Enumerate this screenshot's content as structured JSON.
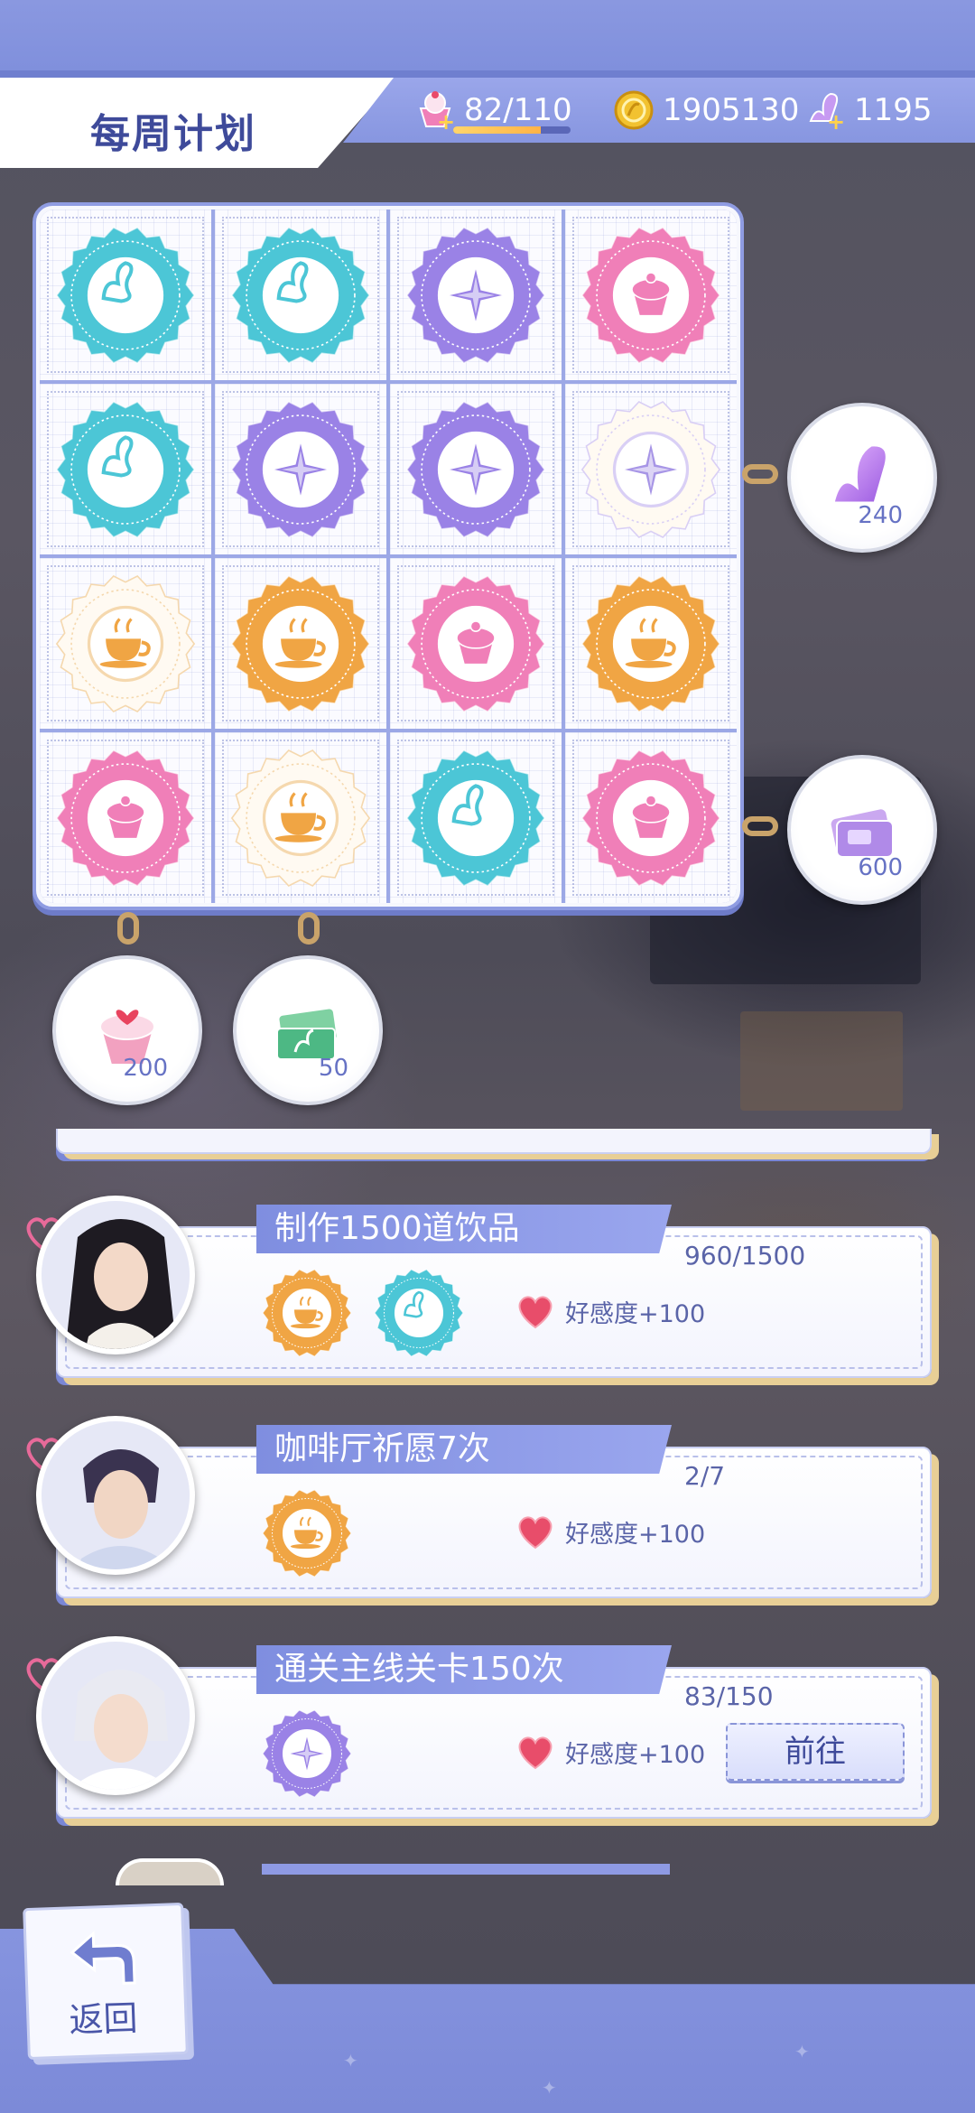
{
  "header": {
    "title": "每周计划",
    "stamina": {
      "value": "82/110",
      "fill": 0.745
    },
    "gold": "1905130",
    "gems": "1195"
  },
  "board": {
    "stamps": [
      [
        "swan-stamp-teal",
        "swan-stamp-teal",
        "compass-stamp-purple",
        "cupcake-stamp-pink"
      ],
      [
        "swan-stamp-teal",
        "compass-stamp-purple",
        "compass-stamp-purple",
        "compass-stamp-faded"
      ],
      [
        "coffee-stamp-faded",
        "coffee-stamp-orange",
        "cupcake-stamp-pink",
        "coffee-stamp-orange"
      ],
      [
        "cupcake-stamp-pink",
        "coffee-stamp-faded",
        "swan-stamp-teal",
        "cupcake-stamp-pink"
      ]
    ],
    "row_rewards": [
      {
        "icon": "crystal-swan-icon",
        "amount": "240"
      },
      {
        "icon": "ticket-card-icon",
        "amount": "600"
      }
    ],
    "column_rewards": [
      {
        "icon": "cupcake-icon",
        "amount": "200"
      },
      {
        "icon": "swan-ticket-icon",
        "amount": "50"
      }
    ]
  },
  "tasks": [
    {
      "title": "制作1500道饮品",
      "progress": "960/1500",
      "reward_stamps": [
        "coffee-stamp-orange",
        "swan-stamp-teal"
      ],
      "affinity": "好感度+100",
      "avatar": "long-black-hair-man-avatar"
    },
    {
      "title": "咖啡厅祈愿7次",
      "progress": "2/7",
      "reward_stamps": [
        "coffee-stamp-orange"
      ],
      "affinity": "好感度+100",
      "avatar": "dark-hair-glasses-man-avatar"
    },
    {
      "title": "通关主线关卡150次",
      "progress": "83/150",
      "reward_stamps": [
        "compass-stamp-purple"
      ],
      "affinity": "好感度+100",
      "avatar": "silver-hair-man-avatar",
      "button": "前往"
    }
  ],
  "footer": {
    "back_label": "返回"
  },
  "colors": {
    "accent": "#7f8ee0",
    "teal": "#4cc6d6",
    "purple": "#9a82e6",
    "pink": "#f07fb8",
    "orange": "#f0a544",
    "faded": "#f5d8ae"
  }
}
